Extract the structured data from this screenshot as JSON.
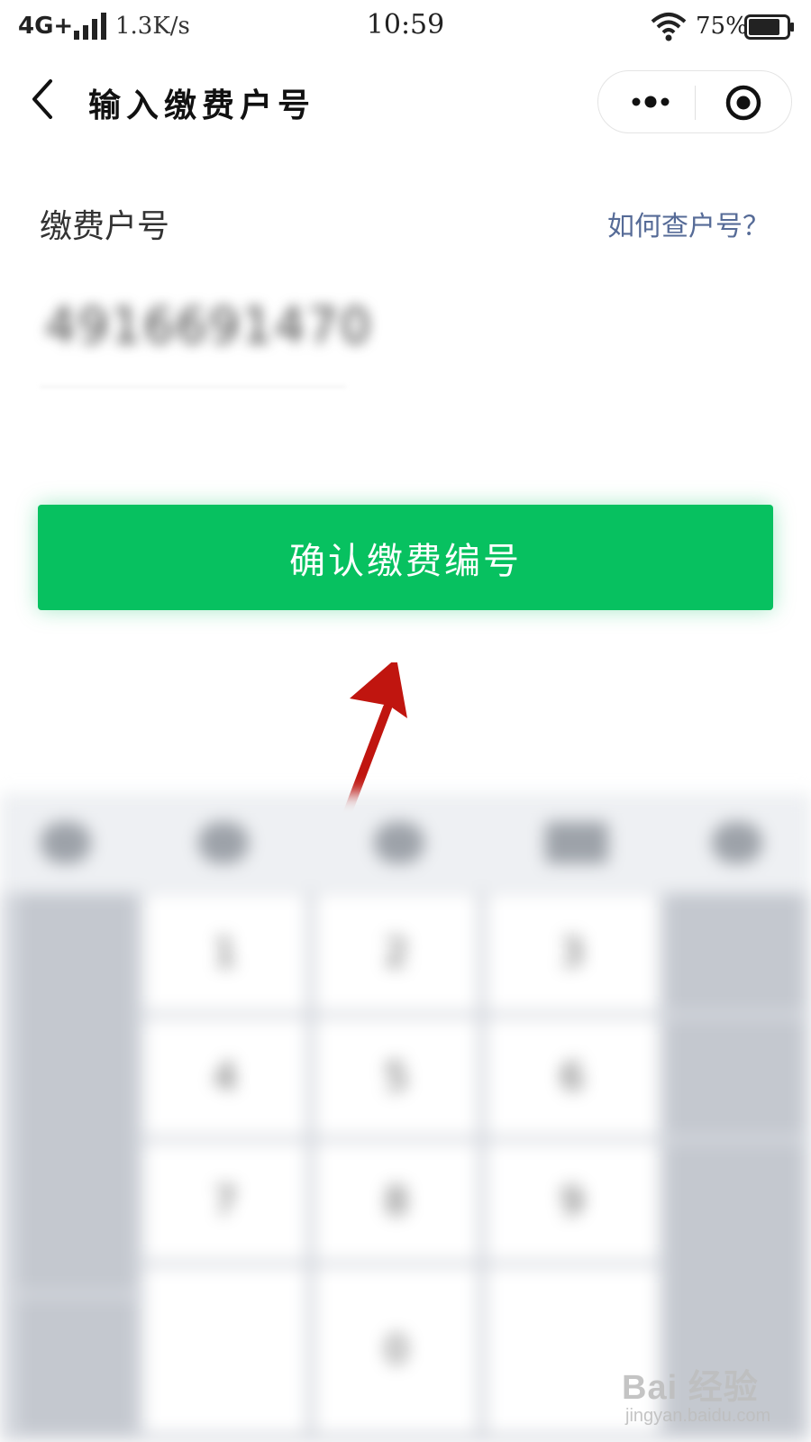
{
  "status": {
    "network": "4G+",
    "speed": "1.3K/s",
    "time": "10:59",
    "battery": "75%"
  },
  "nav": {
    "title": "输入缴费户号"
  },
  "form": {
    "label": "缴费户号",
    "help_link": "如何查户号？",
    "account_value": "4916691470",
    "confirm_label": "确认缴费编号"
  },
  "keyboard": {
    "keys": [
      "1",
      "2",
      "3",
      "4",
      "5",
      "6",
      "7",
      "8",
      "9",
      "0"
    ]
  },
  "watermark": {
    "text": "Bai 经验",
    "url": "jingyan.baidu.com"
  },
  "colors": {
    "primary_green": "#07c160",
    "link_blue": "#566b97",
    "arrow_red": "#c0150f"
  }
}
